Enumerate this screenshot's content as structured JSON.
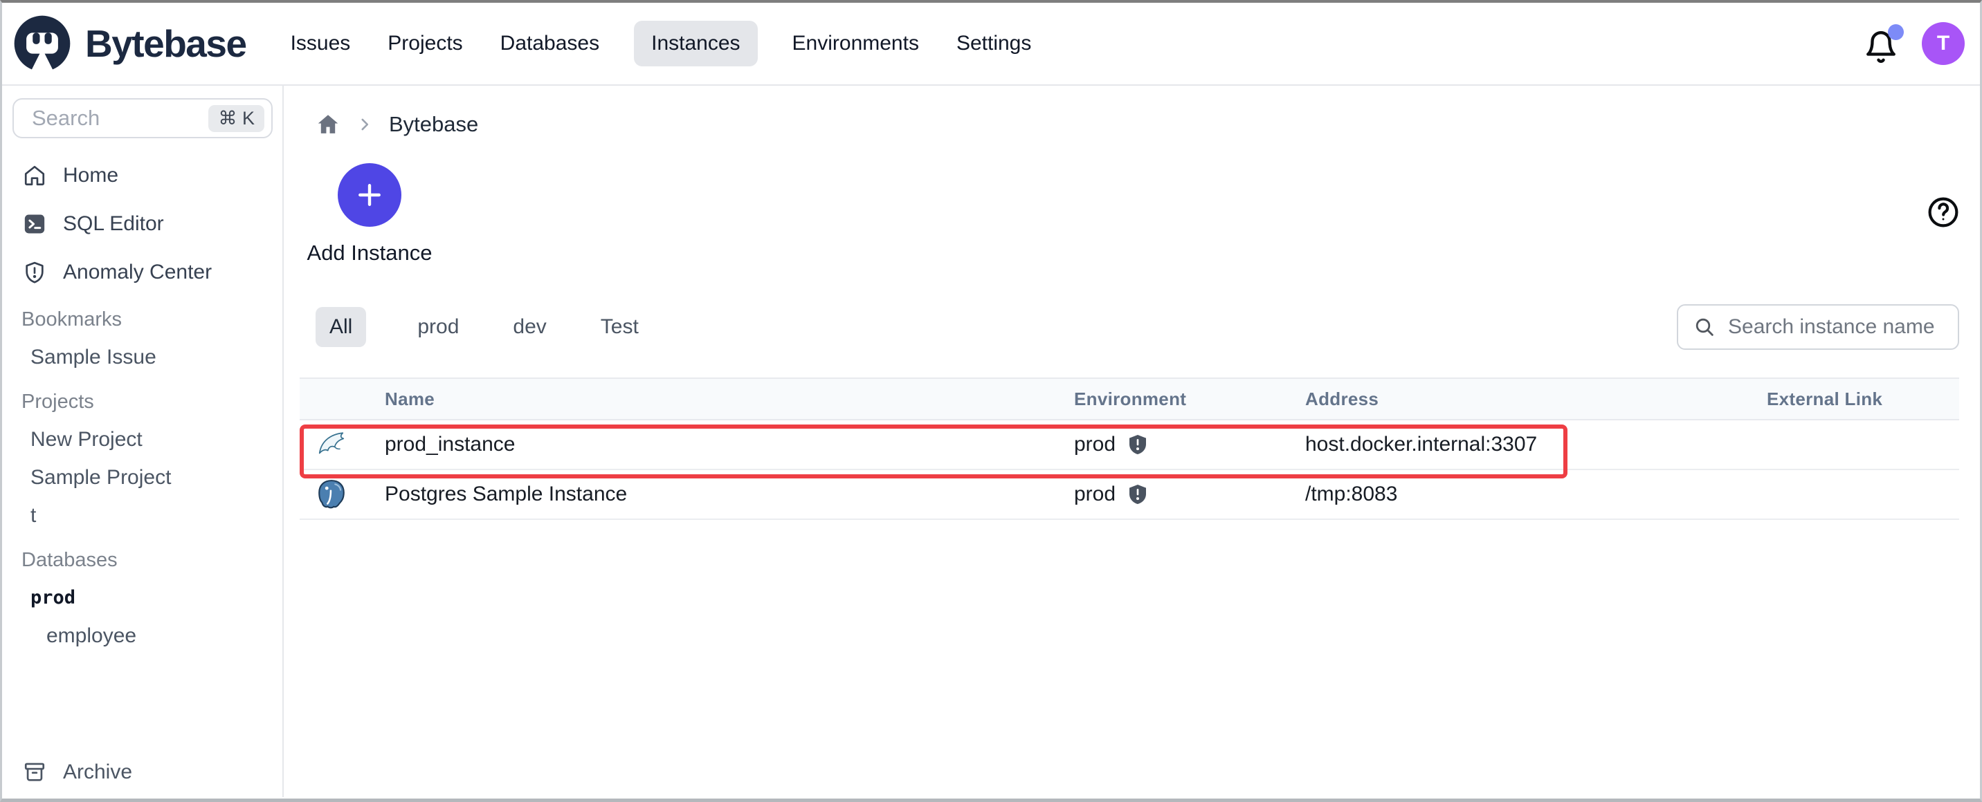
{
  "colors": {
    "accent_indigo": "#4f46e5",
    "avatar_purple": "#a855f7",
    "notification_dot": "#7d8bf7",
    "highlight_red": "#ee3e44",
    "brand_navy": "#1c2941"
  },
  "topbar": {
    "brand": "Bytebase",
    "nav": [
      {
        "label": "Issues",
        "active": false
      },
      {
        "label": "Projects",
        "active": false
      },
      {
        "label": "Databases",
        "active": false
      },
      {
        "label": "Instances",
        "active": true
      },
      {
        "label": "Environments",
        "active": false
      },
      {
        "label": "Settings",
        "active": false
      }
    ],
    "notification_icon": "bell-icon",
    "avatar_initial": "T"
  },
  "sidebar": {
    "search": {
      "placeholder": "Search",
      "shortcut": "⌘ K"
    },
    "main_items": [
      {
        "icon": "home-icon",
        "label": "Home"
      },
      {
        "icon": "sql-terminal-icon",
        "label": "SQL Editor"
      },
      {
        "icon": "shield-alert-icon",
        "label": "Anomaly Center"
      }
    ],
    "sections": [
      {
        "title": "Bookmarks",
        "items": [
          {
            "label": "Sample Issue"
          }
        ]
      },
      {
        "title": "Projects",
        "items": [
          {
            "label": "New Project"
          },
          {
            "label": "Sample Project"
          },
          {
            "label": "t"
          }
        ]
      },
      {
        "title": "Databases",
        "items": [
          {
            "label": "prod"
          },
          {
            "label": "employee"
          }
        ]
      }
    ],
    "archive": {
      "icon": "archive-icon",
      "label": "Archive"
    }
  },
  "main": {
    "breadcrumb": {
      "home_icon": "home-filled-icon",
      "current": "Bytebase"
    },
    "help_icon": "help-circle-icon",
    "add_instance": {
      "label": "Add Instance",
      "icon": "plus-icon"
    },
    "tabs": [
      {
        "label": "All",
        "active": true
      },
      {
        "label": "prod",
        "active": false
      },
      {
        "label": "dev",
        "active": false
      },
      {
        "label": "Test",
        "active": false
      }
    ],
    "instance_search": {
      "placeholder": "Search instance name",
      "icon": "search-icon"
    },
    "table": {
      "columns": [
        "Name",
        "Environment",
        "Address",
        "External Link"
      ],
      "rows": [
        {
          "engine_icon": "mysql-dolphin-icon",
          "name": "prod_instance",
          "environment": "prod",
          "environment_icon": "shield-check-icon",
          "address": "host.docker.internal:3307",
          "external_link": "",
          "highlighted": true
        },
        {
          "engine_icon": "postgres-elephant-icon",
          "name": "Postgres Sample Instance",
          "environment": "prod",
          "environment_icon": "shield-check-icon",
          "address": "/tmp:8083",
          "external_link": "",
          "highlighted": false
        }
      ]
    }
  }
}
